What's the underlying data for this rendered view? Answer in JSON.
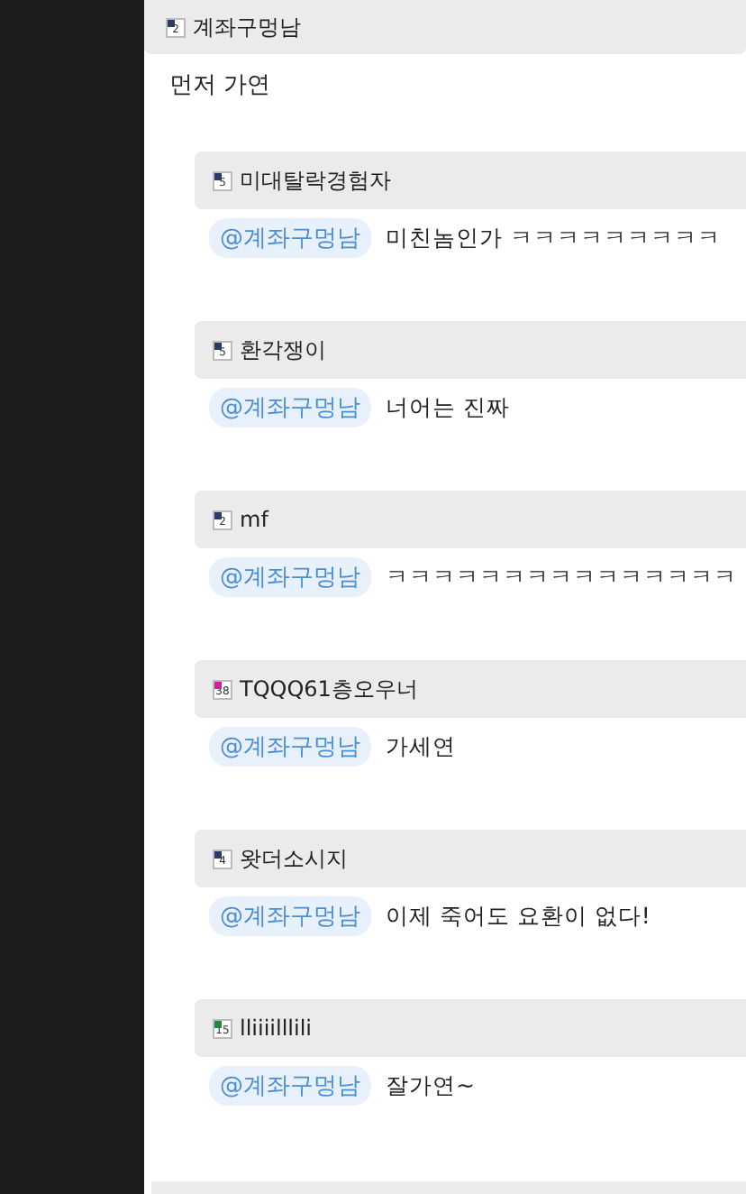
{
  "comment": {
    "author": {
      "level": "2",
      "color": "#2b3a67",
      "name": "계좌구멍남"
    },
    "text": "먼저 가연"
  },
  "replies": [
    {
      "author": {
        "level": "5",
        "color": "#2b3a67",
        "name": "미대탈락경험자"
      },
      "mention": "@계좌구멍남",
      "text": "미친놈인가 ㅋㅋㅋㅋㅋㅋㅋㅋㅋ"
    },
    {
      "author": {
        "level": "5",
        "color": "#2b3a67",
        "name": "환각쟁이"
      },
      "mention": "@계좌구멍남",
      "text": "너어는 진짜"
    },
    {
      "author": {
        "level": "2",
        "color": "#2b3a67",
        "name": "mf"
      },
      "mention": "@계좌구멍남",
      "text": "ㅋㅋㅋㅋㅋㅋㅋㅋㅋㅋㅋㅋㅋㅋㅋ"
    },
    {
      "author": {
        "level": "38",
        "color": "#d0209a",
        "name": "TQQQ61층오우너"
      },
      "mention": "@계좌구멍남",
      "text": "가세연"
    },
    {
      "author": {
        "level": "4",
        "color": "#2b3a67",
        "name": "왓더소시지"
      },
      "mention": "@계좌구멍남",
      "text": "이제 죽어도 요환이 없다!"
    },
    {
      "author": {
        "level": "15",
        "color": "#1f8a3a",
        "name": "lliiiilllili"
      },
      "mention": "@계좌구멍남",
      "text": "잘가연~"
    }
  ]
}
